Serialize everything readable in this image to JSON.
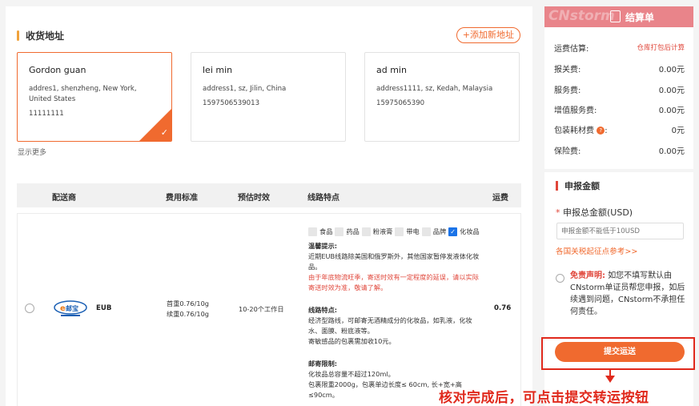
{
  "address_section": {
    "title": "收货地址",
    "add_button": "+添加新地址",
    "show_more": "显示更多",
    "cards": [
      {
        "name": "Gordon guan",
        "address": "addres1, shenzheng, New York, United States",
        "phone": "11111111",
        "selected": true
      },
      {
        "name": "lei min",
        "address": "address1, sz, Jilin, China",
        "phone": "1597506539013",
        "selected": false
      },
      {
        "name": "ad min",
        "address": "address1111, sz, Kedah, Malaysia",
        "phone": "15975065390",
        "selected": false
      }
    ]
  },
  "shipping_table": {
    "headers": {
      "carrier": "配送商",
      "fee": "费用标准",
      "eta": "预估时效",
      "features": "线路特点",
      "price": "运费"
    },
    "row": {
      "carrier_name": "EUB",
      "logo_text": "e邮宝",
      "fee_line1": "首重0.76/10g",
      "fee_line2": "续重0.76/10g",
      "eta": "10-20个工作日",
      "price": "0.76",
      "tags": [
        {
          "label": "食品",
          "checked": false
        },
        {
          "label": "药品",
          "checked": false
        },
        {
          "label": "粉液膏",
          "checked": false
        },
        {
          "label": "带电",
          "checked": false
        },
        {
          "label": "品牌",
          "checked": false
        },
        {
          "label": "化妆品",
          "checked": true
        }
      ],
      "tip_title": "温馨提示:",
      "tip_text": "近期EUB线路除美国和俄罗斯外，其他国家暂停发液体化妆品。",
      "tip_red": "由于年底物流旺季，寄送时效有一定程度的延误，请以实际寄送时效为准，敬请了解。",
      "feature_title": "线路特点:",
      "feature_text1": "经济型路线，可邮寄无酒精成分的化妆品，如乳液，化妆水、面膜、粉底液等。",
      "feature_text2": "寄敏感品的包裹需加收10元。",
      "limit_title": "邮寄限制:",
      "limit_text1": "化妆品总容量不超过120ml。",
      "limit_text2": "包裹限重2000g，包裹单边长度≤ 60cm, 长+宽+高≤90cm。"
    }
  },
  "summary": {
    "watermark": "CNstorm",
    "title": "结算单",
    "rows": [
      {
        "label": "运费估算:",
        "value": "仓库打包后计算",
        "red": true
      },
      {
        "label": "报关费:",
        "value": "0.00元"
      },
      {
        "label": "服务费:",
        "value": "0.00元"
      },
      {
        "label": "增值服务费:",
        "value": "0.00元"
      },
      {
        "label": "包装耗材费",
        "value": "0元"
      },
      {
        "label": "保险费:",
        "value": "0.00元"
      }
    ]
  },
  "declare": {
    "title": "申报金额",
    "label": "申报总金额(USD)",
    "placeholder": "申报金额不能低于10USD",
    "link": "各国关税起征点参考>>",
    "disclaimer_red": "免责声明:",
    "disclaimer_text": "如您不填写默认由CNstorm单证员帮您申报，如后续遇到问题，CNstorm不承担任何责任。"
  },
  "submit_button": "提交运送",
  "annotation": "核对完成后，可点击提交转运按钮",
  "colors": {
    "accent": "#f06a2f",
    "summary_header": "#e9848a",
    "annotation": "#e0291c"
  }
}
